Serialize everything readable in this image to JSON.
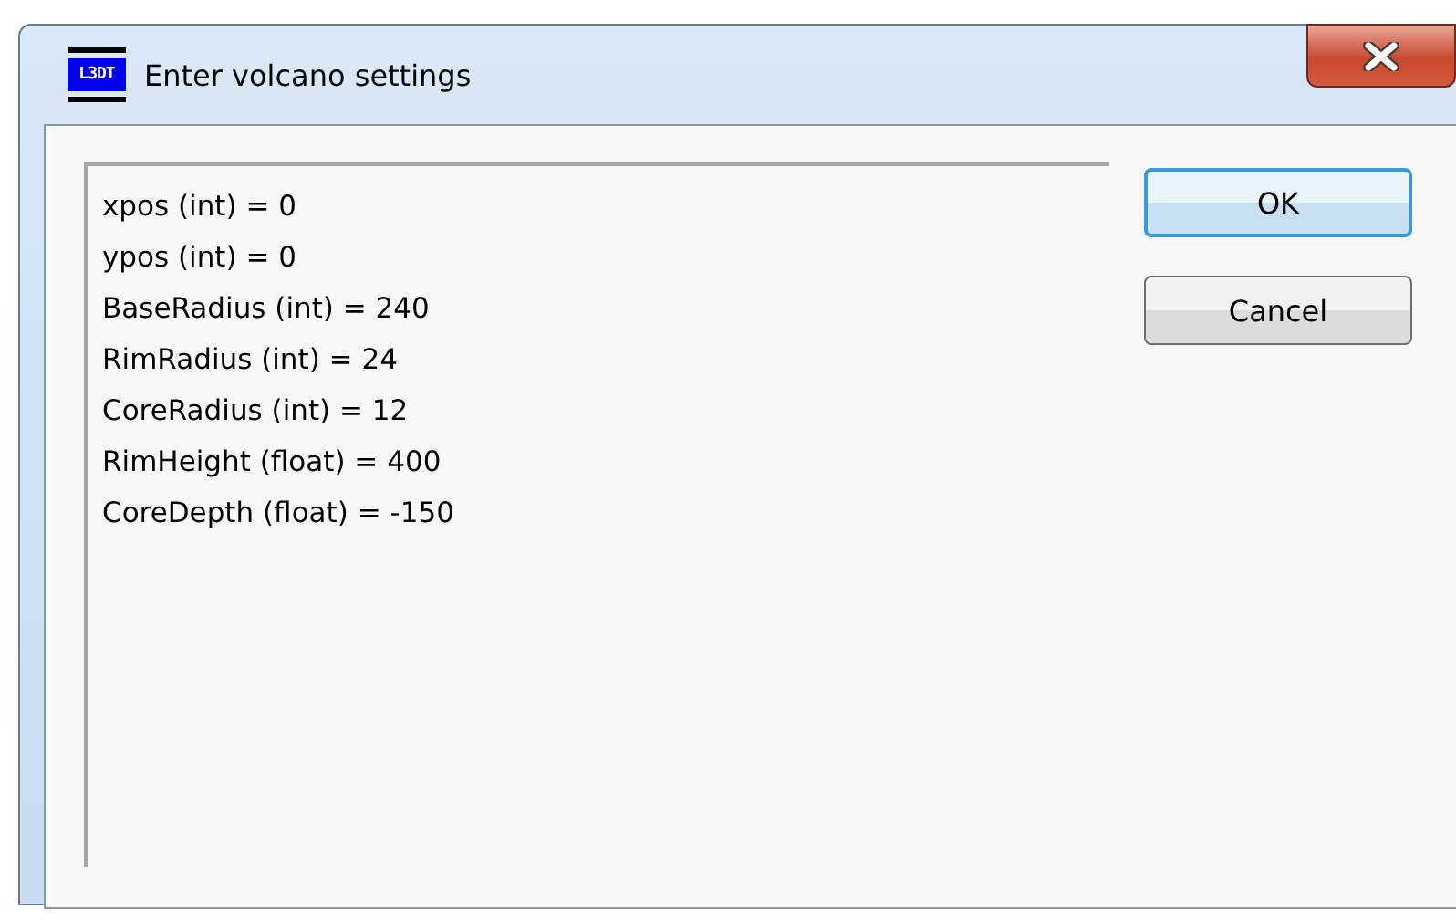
{
  "window": {
    "title": "Enter volcano settings",
    "app_icon_text": "L3DT"
  },
  "settings_lines": [
    "xpos (int) = 0",
    "ypos (int) = 0",
    "BaseRadius (int) = 240",
    "RimRadius (int) = 24",
    "CoreRadius (int) = 12",
    "RimHeight (float) = 400",
    "CoreDepth (float) = -150"
  ],
  "buttons": [
    {
      "label": "OK",
      "default": true
    },
    {
      "label": "Cancel",
      "default": false
    }
  ]
}
